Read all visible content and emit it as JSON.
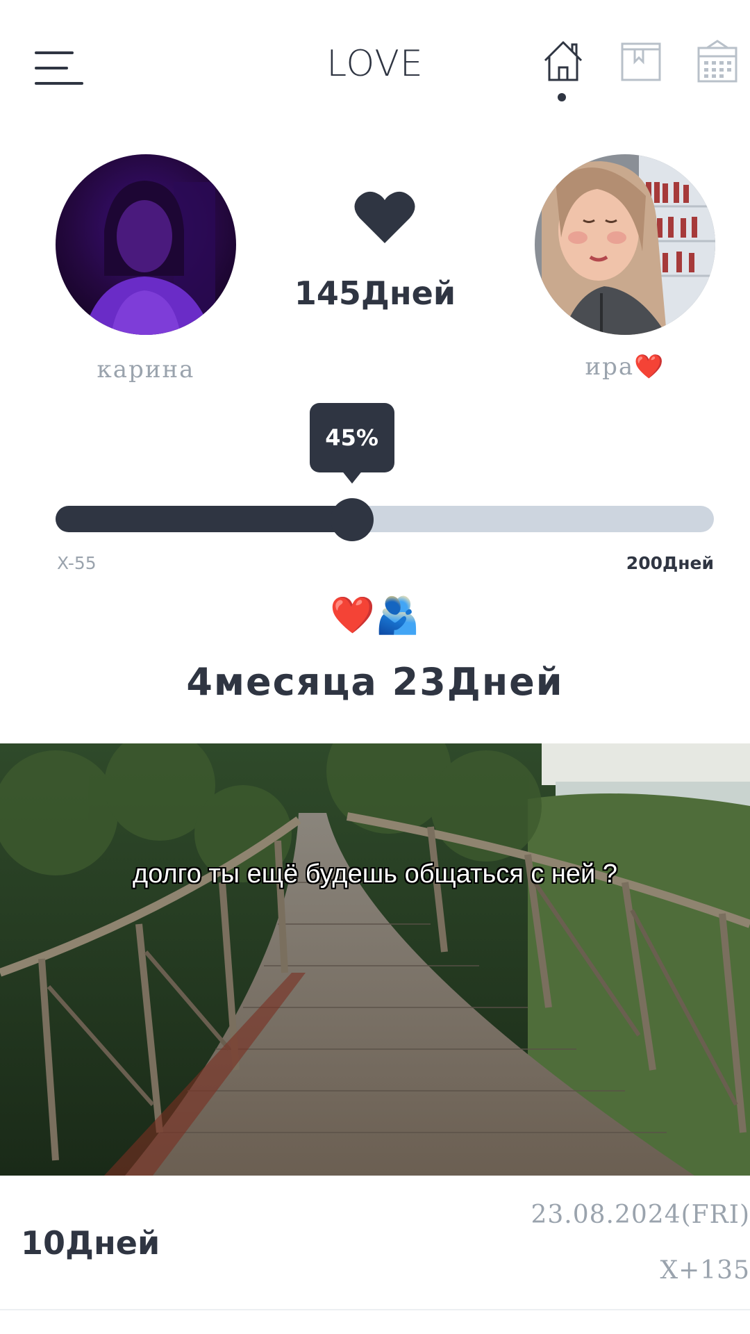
{
  "header": {
    "title": "LOVE",
    "menu_icon": "hamburger-icon",
    "nav": [
      {
        "icon": "home-icon",
        "active": true
      },
      {
        "icon": "book-icon",
        "active": false
      },
      {
        "icon": "calendar-icon",
        "active": false
      }
    ]
  },
  "couple": {
    "left_name": "карина",
    "right_name": "ира❤️",
    "heart_icon": "heart-icon",
    "days_together": "145Дней"
  },
  "progress": {
    "percent": 45,
    "percent_label": "45%",
    "left_label": "X-55",
    "right_label": "200Дней"
  },
  "emoji_row": "❤️🫂",
  "duration": "4месяца 23Дней",
  "photo": {
    "caption": "долго ты ещё будешь общаться с ней ?"
  },
  "footer": {
    "days": "10Дней",
    "date": "23.08.2024(FRI)",
    "x_count": "X+135"
  },
  "colors": {
    "primary": "#2f3542",
    "track": "#cdd5df",
    "muted": "#9aa3ad"
  }
}
